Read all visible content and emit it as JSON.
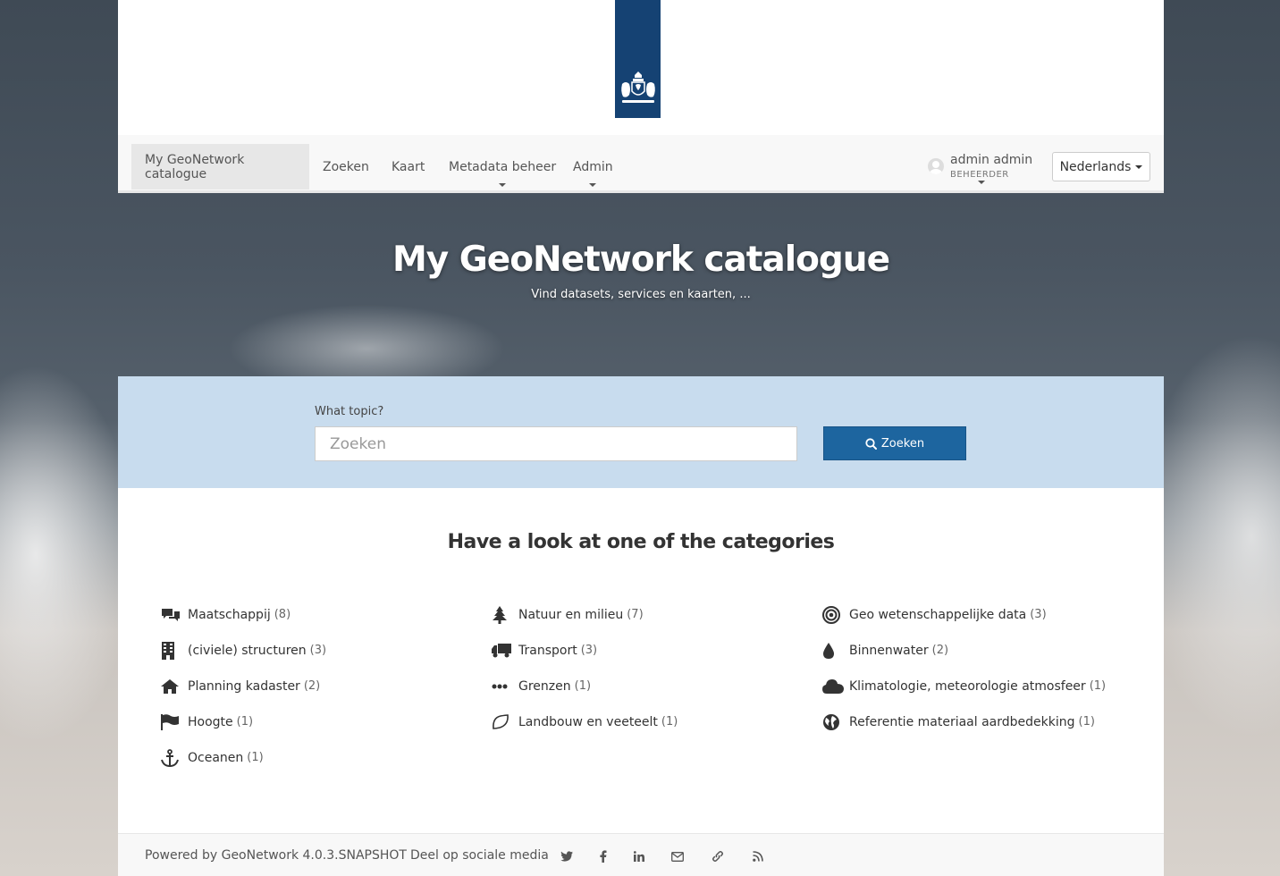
{
  "nav": {
    "items": [
      {
        "label": "My GeoNetwork catalogue",
        "active": true
      },
      {
        "label": "Zoeken"
      },
      {
        "label": "Kaart"
      },
      {
        "label": "Metadata beheer"
      },
      {
        "label": "Admin"
      }
    ],
    "user": {
      "name": "admin admin",
      "role": "BEHEERDER"
    },
    "language": "Nederlands"
  },
  "hero": {
    "title": "My GeoNetwork catalogue",
    "subtitle": "Vind datasets, services en kaarten, ..."
  },
  "search": {
    "label": "What topic?",
    "placeholder": "Zoeken",
    "button": "Zoeken"
  },
  "categories": {
    "heading": "Have a look at one of the categories",
    "col1": [
      {
        "label": "Maatschappij",
        "count": "(8)",
        "icon": "comments-icon"
      },
      {
        "label": "(civiele) structuren",
        "count": "(3)",
        "icon": "building-icon"
      },
      {
        "label": "Planning kadaster",
        "count": "(2)",
        "icon": "home-icon"
      },
      {
        "label": "Hoogte",
        "count": "(1)",
        "icon": "flag-icon"
      },
      {
        "label": "Oceanen",
        "count": "(1)",
        "icon": "anchor-icon"
      }
    ],
    "col2": [
      {
        "label": "Natuur en milieu",
        "count": "(7)",
        "icon": "tree-icon"
      },
      {
        "label": "Transport",
        "count": "(3)",
        "icon": "truck-icon"
      },
      {
        "label": "Grenzen",
        "count": "(1)",
        "icon": "ellipsis-icon"
      },
      {
        "label": "Landbouw en veeteelt",
        "count": "(1)",
        "icon": "leaf-icon"
      }
    ],
    "col3": [
      {
        "label": "Geo wetenschappelijke data",
        "count": "(3)",
        "icon": "bullseye-icon"
      },
      {
        "label": "Binnenwater",
        "count": "(2)",
        "icon": "tint-icon"
      },
      {
        "label": "Klimatologie, meteorologie atmosfeer",
        "count": "(1)",
        "icon": "cloud-icon"
      },
      {
        "label": "Referentie materiaal aardbedekking",
        "count": "(1)",
        "icon": "globe-icon"
      }
    ]
  },
  "footer": {
    "powered": "Powered by GeoNetwork 4.0.3.SNAPSHOT",
    "share": "Deel op sociale media",
    "social": [
      "twitter-icon",
      "facebook-icon",
      "linkedin-icon",
      "email-icon",
      "link-icon",
      "rss-icon"
    ]
  },
  "colors": {
    "brand_blue": "#154273",
    "search_band": "#c8dcee",
    "button_blue": "#1d659f"
  }
}
